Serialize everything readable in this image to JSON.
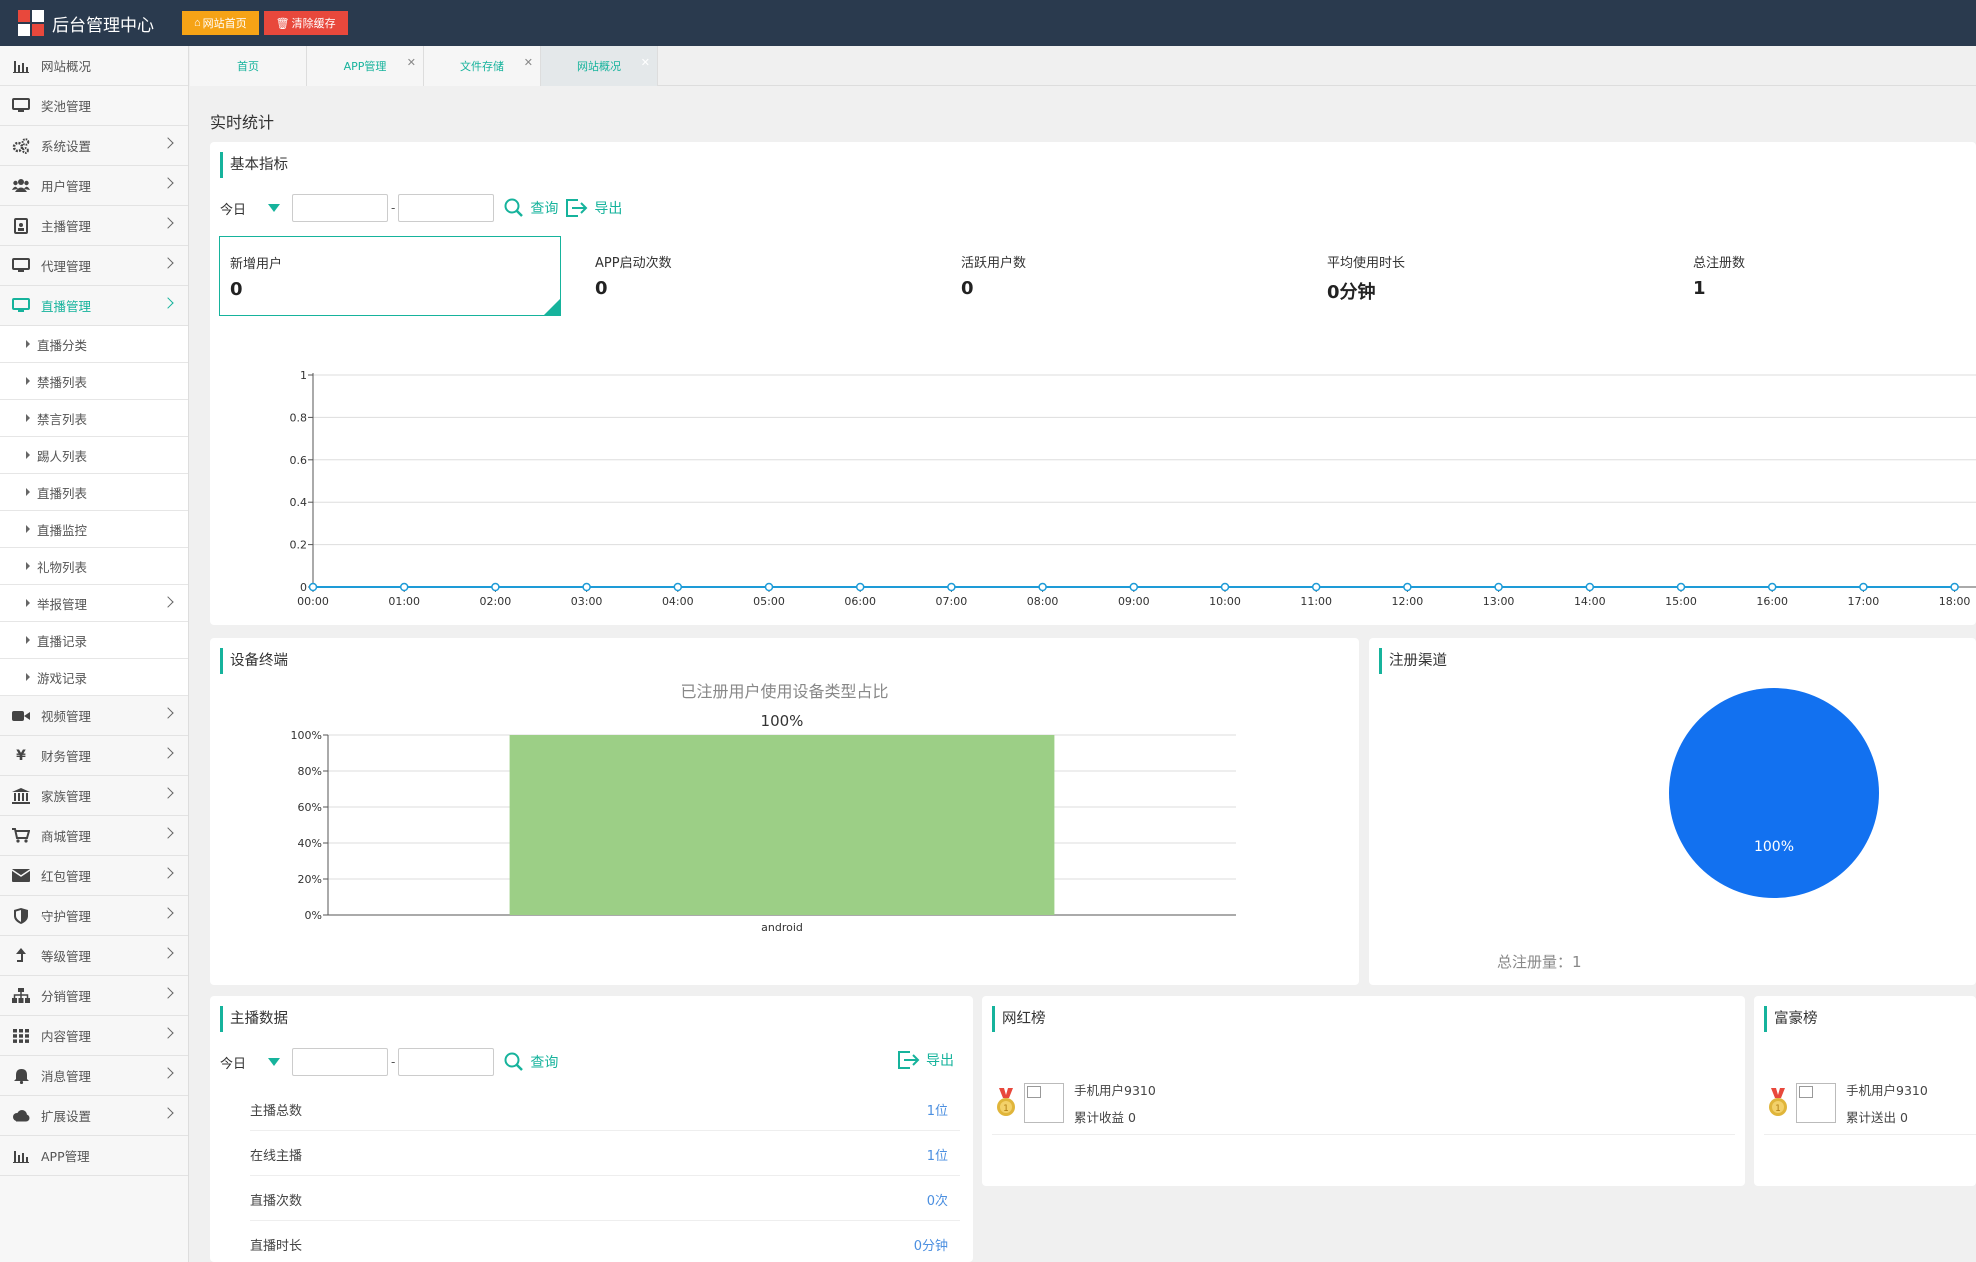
{
  "header": {
    "title": "后台管理中心",
    "btn_home": "网站首页",
    "btn_clear": "清除缓存",
    "colors": {
      "bar": "#2a3a4e",
      "orange": "#f6a316",
      "red": "#e8483c",
      "accent": "#16b39c"
    }
  },
  "sidebar": {
    "items": [
      {
        "label": "网站概况",
        "icon": "bar-chart-icon",
        "chevron": false
      },
      {
        "label": "奖池管理",
        "icon": "monitor-icon",
        "chevron": false
      },
      {
        "label": "系统设置",
        "icon": "gears-icon",
        "chevron": true
      },
      {
        "label": "用户管理",
        "icon": "users-icon",
        "chevron": true
      },
      {
        "label": "主播管理",
        "icon": "badge-icon",
        "chevron": true
      },
      {
        "label": "代理管理",
        "icon": "monitor-icon",
        "chevron": true
      },
      {
        "label": "直播管理",
        "icon": "monitor-icon",
        "chevron": true,
        "active": true
      }
    ],
    "sub_items": [
      "直播分类",
      "禁播列表",
      "禁言列表",
      "踢人列表",
      "直播列表",
      "直播监控",
      "礼物列表",
      "举报管理",
      "直播记录",
      "游戏记录"
    ],
    "items_after": [
      {
        "label": "视频管理",
        "icon": "video-camera-icon"
      },
      {
        "label": "财务管理",
        "icon": "yen-icon"
      },
      {
        "label": "家族管理",
        "icon": "bank-icon"
      },
      {
        "label": "商城管理",
        "icon": "cart-icon"
      },
      {
        "label": "红包管理",
        "icon": "envelope-icon"
      },
      {
        "label": "守护管理",
        "icon": "shield-icon"
      },
      {
        "label": "等级管理",
        "icon": "level-up-icon"
      },
      {
        "label": "分销管理",
        "icon": "sitemap-icon"
      },
      {
        "label": "内容管理",
        "icon": "grid-icon"
      },
      {
        "label": "消息管理",
        "icon": "bell-icon"
      },
      {
        "label": "扩展设置",
        "icon": "cloud-icon"
      },
      {
        "label": "APP管理",
        "icon": "bar-chart-icon",
        "chevron": false
      }
    ]
  },
  "tabs": [
    {
      "label": "首页",
      "closable": false
    },
    {
      "label": "APP管理",
      "closable": true
    },
    {
      "label": "文件存储",
      "closable": true
    },
    {
      "label": "网站概况",
      "closable": true,
      "active": true
    }
  ],
  "page_title": "实时统计",
  "basic": {
    "title": "基本指标",
    "range_label": "今日",
    "query": "查询",
    "export": "导出",
    "metrics": [
      {
        "label": "新增用户",
        "value": "0"
      },
      {
        "label": "APP启动次数",
        "value": "0"
      },
      {
        "label": "活跃用户数",
        "value": "0"
      },
      {
        "label": "平均使用时长",
        "value": "0分钟"
      },
      {
        "label": "总注册数",
        "value": "1"
      }
    ]
  },
  "device": {
    "title": "设备终端",
    "chart_title": "已注册用户使用设备类型占比",
    "bar_label": "100%"
  },
  "channel": {
    "title": "注册渠道",
    "slice_label": "100%",
    "total": "总注册量：1"
  },
  "anchor": {
    "title": "主播数据",
    "range_label": "今日",
    "query": "查询",
    "export": "导出",
    "rows": [
      {
        "label": "主播总数",
        "value": "1位"
      },
      {
        "label": "在线主播",
        "value": "1位"
      },
      {
        "label": "直播次数",
        "value": "0次"
      },
      {
        "label": "直播时长",
        "value": "0分钟"
      }
    ]
  },
  "influencer": {
    "title": "网红榜",
    "name": "手机用户9310",
    "sub": "累计收益 0"
  },
  "rich": {
    "title": "富豪榜",
    "name": "手机用户9310",
    "sub": "累计送出 0"
  },
  "chart_data": [
    {
      "type": "line",
      "x": [
        "00:00",
        "01:00",
        "02:00",
        "03:00",
        "04:00",
        "05:00",
        "06:00",
        "07:00",
        "08:00",
        "09:00",
        "10:00",
        "11:00",
        "12:00",
        "13:00",
        "14:00",
        "15:00",
        "16:00",
        "17:00",
        "18:00"
      ],
      "series": [
        {
          "values": [
            0,
            0,
            0,
            0,
            0,
            0,
            0,
            0,
            0,
            0,
            0,
            0,
            0,
            0,
            0,
            0,
            0,
            0,
            0
          ]
        }
      ],
      "ylim": [
        0,
        1
      ],
      "yticks": [
        "0",
        "0.2",
        "0.4",
        "0.6",
        "0.8",
        "1"
      ],
      "grid": true,
      "color": "#1e9bd7"
    },
    {
      "type": "bar",
      "title": "已注册用户使用设备类型占比",
      "categories": [
        "android"
      ],
      "values": [
        100
      ],
      "ylim": [
        0,
        100
      ],
      "yticks": [
        "0%",
        "20%",
        "40%",
        "60%",
        "80%",
        "100%"
      ],
      "data_labels": [
        "100%"
      ],
      "color": "#9ccf86"
    },
    {
      "type": "pie",
      "values": [
        100
      ],
      "data_labels": [
        "100%"
      ],
      "color": "#1271f0"
    }
  ]
}
